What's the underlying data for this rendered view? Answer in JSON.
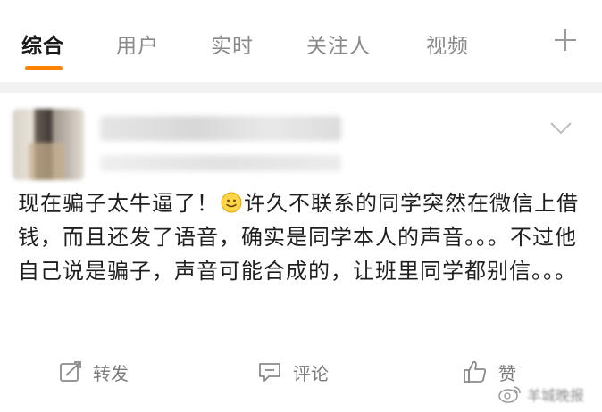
{
  "tabs": [
    {
      "label": "综合",
      "active": true
    },
    {
      "label": "用户",
      "active": false
    },
    {
      "label": "实时",
      "active": false
    },
    {
      "label": "关注人",
      "active": false
    },
    {
      "label": "视频",
      "active": false
    }
  ],
  "post": {
    "text_before_emoji": "现在骗子太牛逼了！",
    "emoji": "smile-icon",
    "text_after_emoji": "许久不联系的同学突然在微信上借钱，而且还发了语音，确实是同学本人的声音。。。不过他自己说是骗子，声音可能合成的，让班里同学都别信。。。"
  },
  "actions": {
    "repost_label": "转发",
    "comment_label": "评论",
    "like_label": "赞"
  },
  "watermark": {
    "text": "羊城晚报"
  },
  "colors": {
    "accent": "#ff8200",
    "inactive_tab": "#8a8a8a",
    "action_gray": "#7a7a7a"
  }
}
